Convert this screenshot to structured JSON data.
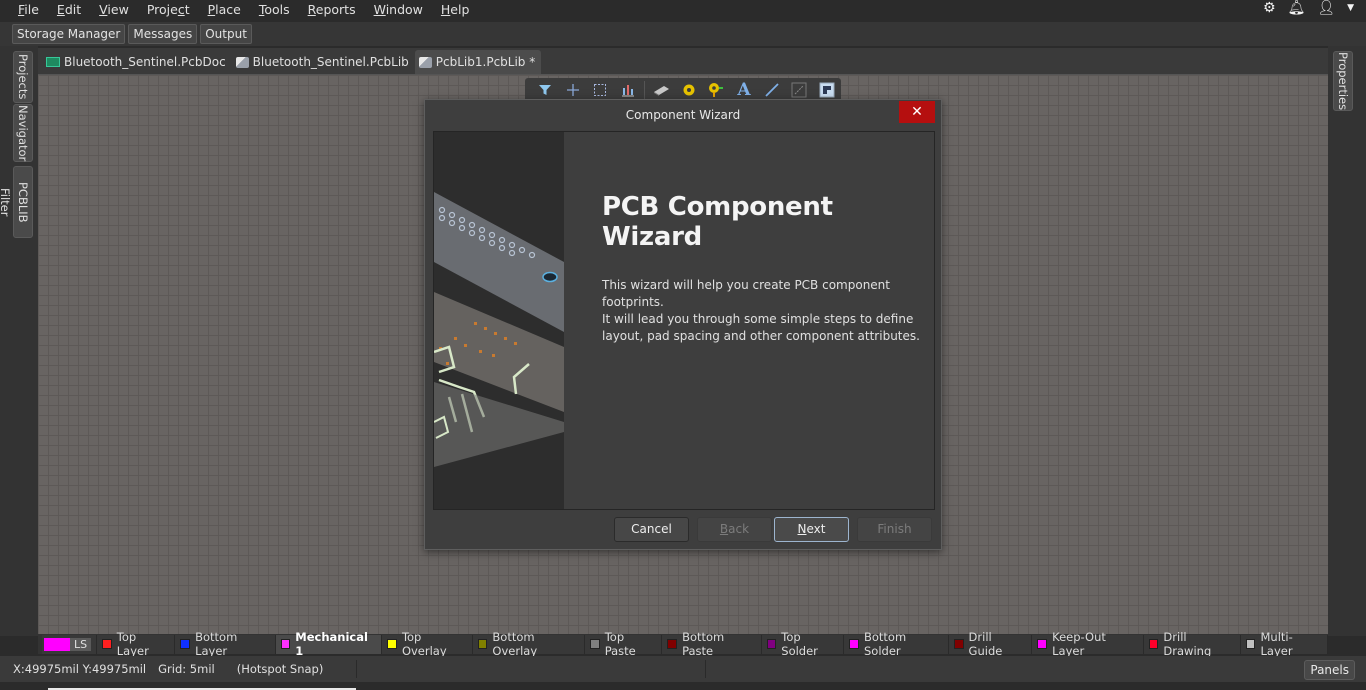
{
  "menu": {
    "items": [
      {
        "label": "File",
        "accel": "F"
      },
      {
        "label": "Edit",
        "accel": "E"
      },
      {
        "label": "View",
        "accel": "V"
      },
      {
        "label": "Project",
        "accel": "c"
      },
      {
        "label": "Place",
        "accel": "P"
      },
      {
        "label": "Tools",
        "accel": "T"
      },
      {
        "label": "Reports",
        "accel": "R"
      },
      {
        "label": "Window",
        "accel": "W"
      },
      {
        "label": "Help",
        "accel": "H"
      }
    ],
    "right_icons": [
      "gear-icon",
      "bell-icon",
      "user-icon",
      "dropdown-arrow-icon"
    ]
  },
  "panel_buttons": [
    "Storage Manager",
    "Messages",
    "Output"
  ],
  "left_panels": [
    "Projects",
    "Navigator",
    "PCBLIB Filter"
  ],
  "right_panels": [
    "Properties"
  ],
  "doc_tabs": [
    {
      "label": "Bluetooth_Sentinel.PcbDoc",
      "icon": "pcbdoc-icon",
      "active": false
    },
    {
      "label": "Bluetooth_Sentinel.PcbLib",
      "icon": "pcblib-icon",
      "active": false
    },
    {
      "label": "PcbLib1.PcbLib *",
      "icon": "pcblib-icon",
      "active": true
    }
  ],
  "toolbar": {
    "icons": [
      "filter-icon",
      "crosshair-icon",
      "select-rect-icon",
      "align-chart-icon",
      "component-chip-icon",
      "pad-icon",
      "via-icon",
      "text-icon",
      "line-icon",
      "dimension-icon",
      "region-icon"
    ]
  },
  "dialog": {
    "title": "Component Wizard",
    "heading": "PCB Component Wizard",
    "paragraph1": "This wizard will help you create PCB component footprints.",
    "paragraph2": "It will lead you through some simple steps to define layout, pad spacing and other component attributes.",
    "buttons": {
      "cancel": "Cancel",
      "back": "Back",
      "next": "Next",
      "finish": "Finish"
    }
  },
  "layers": {
    "ls_color": "#ff00ff",
    "ls_label": "LS",
    "items": [
      {
        "label": "Top Layer",
        "color": "#ff2020",
        "active": false
      },
      {
        "label": "Bottom Layer",
        "color": "#1030ff",
        "active": false
      },
      {
        "label": "Mechanical 1",
        "color": "#ff30ff",
        "active": true
      },
      {
        "label": "Top Overlay",
        "color": "#ffff00",
        "active": false
      },
      {
        "label": "Bottom Overlay",
        "color": "#808000",
        "active": false
      },
      {
        "label": "Top Paste",
        "color": "#808080",
        "active": false
      },
      {
        "label": "Bottom Paste",
        "color": "#800000",
        "active": false
      },
      {
        "label": "Top Solder",
        "color": "#800080",
        "active": false
      },
      {
        "label": "Bottom Solder",
        "color": "#ff00ff",
        "active": false
      },
      {
        "label": "Drill Guide",
        "color": "#800000",
        "active": false
      },
      {
        "label": "Keep-Out Layer",
        "color": "#ff00ff",
        "active": false
      },
      {
        "label": "Drill Drawing",
        "color": "#ff002a",
        "active": false
      },
      {
        "label": "Multi-Layer",
        "color": "#c0c0c0",
        "active": false
      }
    ]
  },
  "status": {
    "coords": "X:49975mil Y:49975mil",
    "grid": "Grid: 5mil",
    "snap": "(Hotspot Snap)",
    "panels_button": "Panels"
  }
}
